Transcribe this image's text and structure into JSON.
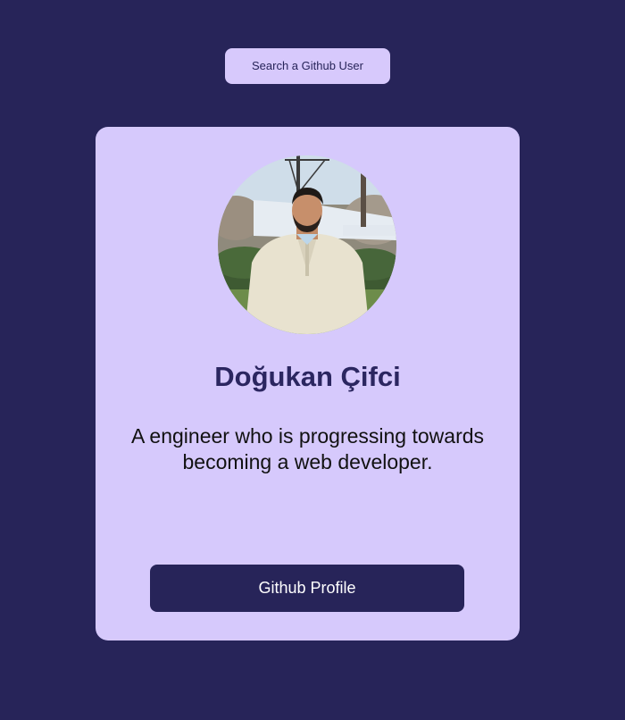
{
  "search": {
    "button_label": "Search a Github User"
  },
  "profile": {
    "avatar_icon": "user-photo",
    "name": "Doğukan Çifci",
    "bio": "A engineer who is progressing towards becoming a web developer.",
    "github_button_label": "Github Profile"
  },
  "colors": {
    "background": "#272459",
    "card": "#d6c9fc",
    "accent": "#272459",
    "name_text": "#2b2660"
  }
}
